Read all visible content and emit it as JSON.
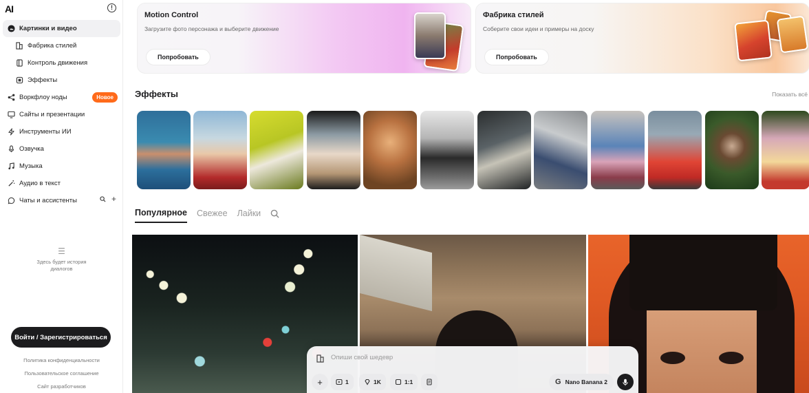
{
  "sidebar": {
    "logo": "AI",
    "nav": [
      {
        "label": "Картинки и видео",
        "icon": "image-icon",
        "active": true
      },
      {
        "label": "Фабрика стилей",
        "icon": "style-icon",
        "sub": true
      },
      {
        "label": "Контроль движения",
        "icon": "motion-icon",
        "sub": true
      },
      {
        "label": "Эффекты",
        "icon": "effects-icon",
        "sub": true
      },
      {
        "label": "Воркфлоу ноды",
        "icon": "workflow-icon",
        "badge": "Новое"
      },
      {
        "label": "Сайты и презентации",
        "icon": "monitor-icon"
      },
      {
        "label": "Инструменты ИИ",
        "icon": "bolt-icon"
      },
      {
        "label": "Озвучка",
        "icon": "mic-icon"
      },
      {
        "label": "Музыка",
        "icon": "music-icon"
      },
      {
        "label": "Аудио в текст",
        "icon": "wand-icon"
      },
      {
        "label": "Чаты и ассистенты",
        "icon": "chat-icon"
      }
    ],
    "history_line1": "Здесь будет история",
    "history_line2": "диалогов",
    "login_label": "Войти / Зарегистрироваться",
    "footer": {
      "privacy": "Политика конфиденциальности",
      "terms": "Пользовательское соглашение",
      "developers": "Сайт разработчиков"
    }
  },
  "promos": [
    {
      "title": "Motion Control",
      "subtitle": "Загрузите фото персонажа и выберите движение",
      "button": "Попробовать"
    },
    {
      "title": "Фабрика стилей",
      "subtitle": "Соберите свои идеи и примеры на доску",
      "button": "Попробовать"
    }
  ],
  "effects": {
    "title": "Эффекты",
    "show_all": "Показать всё"
  },
  "tabs": [
    "Популярное",
    "Свежее",
    "Лайки"
  ],
  "prompt": {
    "placeholder": "Опиши свой шедевр",
    "count": "1",
    "resolution": "1K",
    "ratio": "1:1",
    "model": "Nano Banana 2"
  },
  "colors": {
    "accent_orange": "#ff6a1a",
    "dark": "#1c1c1e"
  }
}
